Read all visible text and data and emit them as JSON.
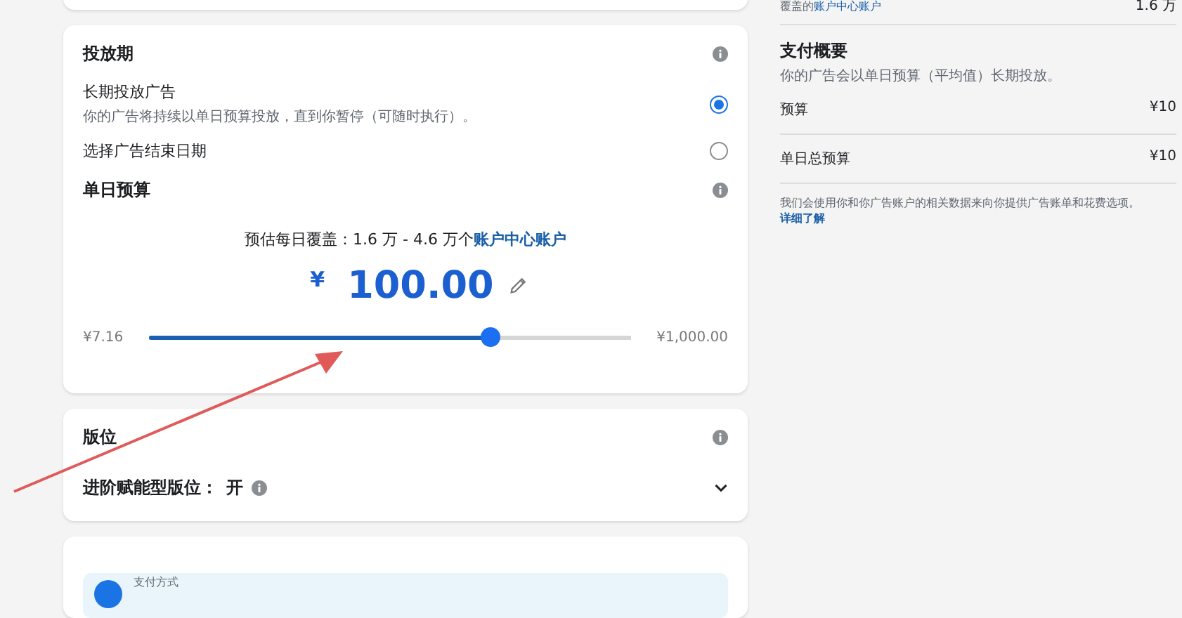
{
  "schedule": {
    "title": "投放期",
    "options": [
      {
        "label": "长期投放广告",
        "description": "你的广告将持续以单日预算投放，直到你暂停（可随时执行）。",
        "selected": true
      },
      {
        "label": "选择广告结束日期",
        "selected": false
      }
    ]
  },
  "budget": {
    "title": "单日预算",
    "estimate": "预估每日覆盖：1.6 万 - 4.6 万个",
    "estimate_link": "账户中心账户",
    "currency": "¥",
    "amount": "100.00",
    "min": "¥7.16",
    "max": "¥1,000.00",
    "level": 0.71
  },
  "placements": {
    "title": "版位",
    "setting_label": "进阶赋能型版位：",
    "setting_value": "开"
  },
  "payment": {
    "label": "支付方式"
  },
  "summary": {
    "reach_label": "覆盖的",
    "reach_link": "账户中心账户",
    "reach_value": "1.6 万",
    "title": "支付概要",
    "subtitle": "你的广告会以单日预算（平均值）长期投放。",
    "rows": [
      {
        "label": "预算",
        "value": "¥10"
      },
      {
        "label": "单日总预算",
        "value": "¥10"
      }
    ],
    "note": "我们会使用你和你广告账户的相关数据来向你提供广告账单和花费选项。",
    "learn_more": "详细了解"
  }
}
